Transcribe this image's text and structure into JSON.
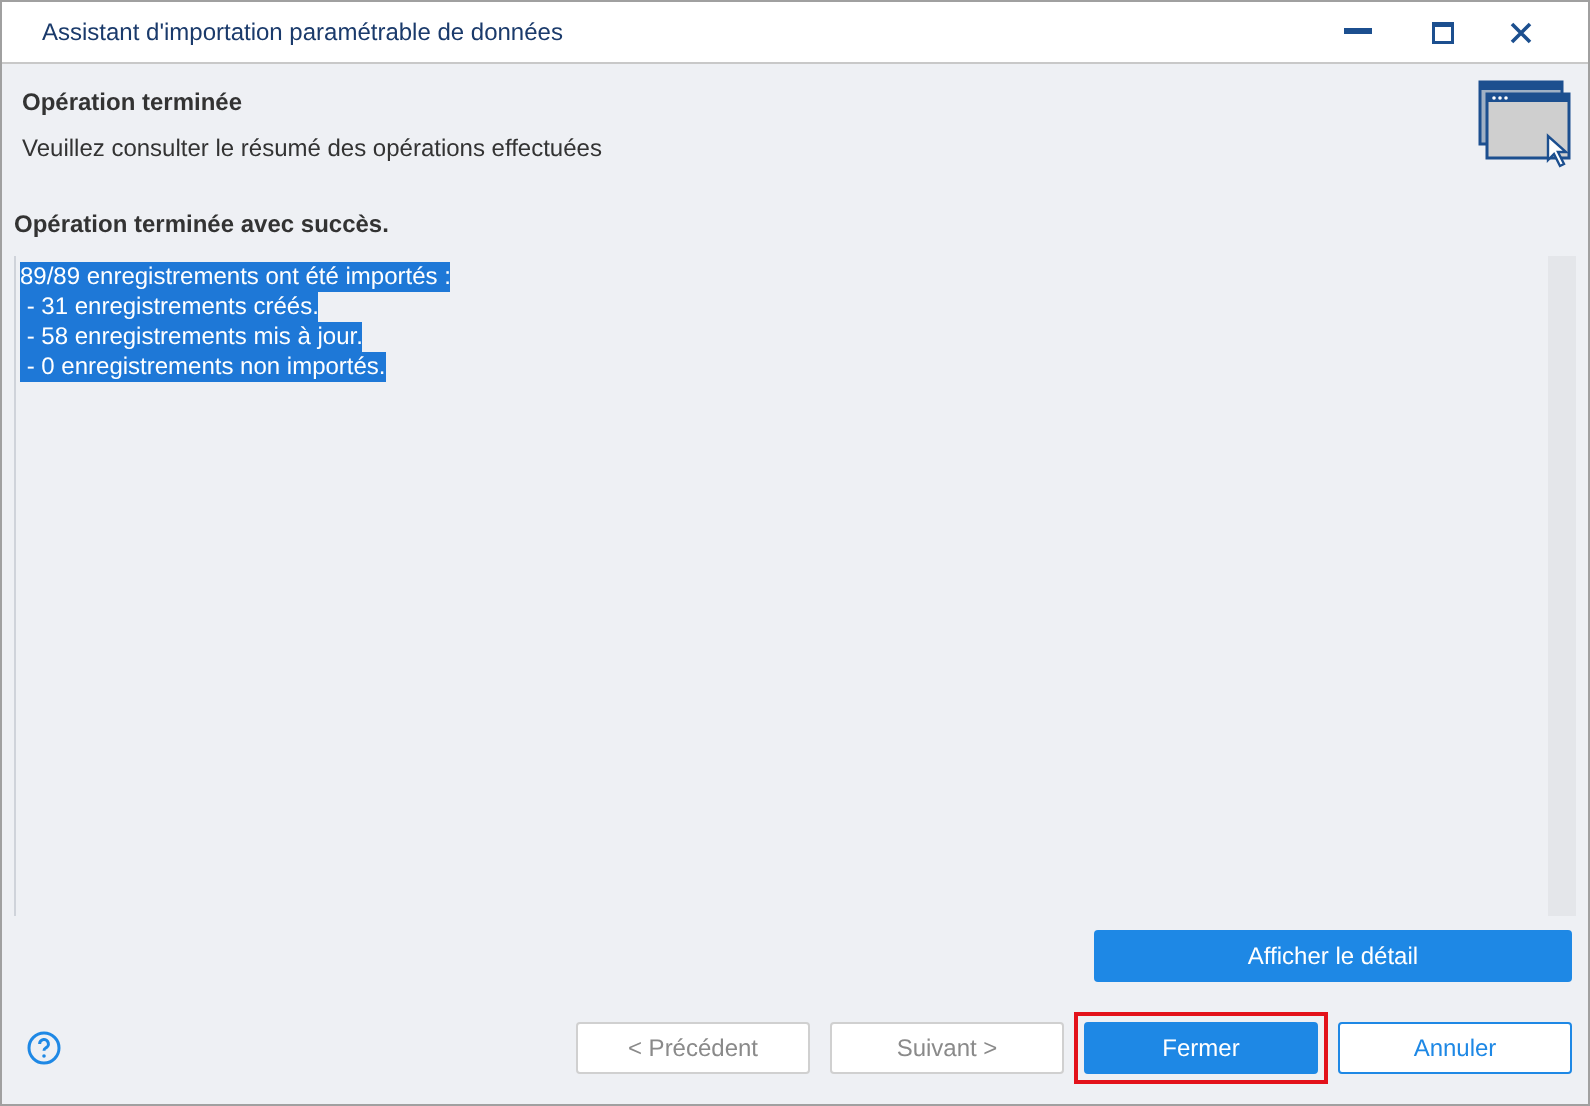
{
  "window": {
    "title": "Assistant d'importation paramétrable de données"
  },
  "header": {
    "title": "Opération terminée",
    "subtitle": "Veuillez consulter le résumé des opérations effectuées"
  },
  "status": "Opération terminée avec succès.",
  "log": {
    "selected": true,
    "lines": [
      "89/89 enregistrements ont été importés :",
      " - 31 enregistrements créés.",
      " - 58 enregistrements mis à jour.",
      " - 0 enregistrements non importés."
    ]
  },
  "detail_button": "Afficher le détail",
  "buttons": [
    {
      "label": "< Précédent",
      "kind": "secondary",
      "disabled": true,
      "highlighted": false
    },
    {
      "label": "Suivant >",
      "kind": "secondary",
      "disabled": true,
      "highlighted": false
    },
    {
      "label": "Fermer",
      "kind": "primary",
      "disabled": false,
      "highlighted": true
    },
    {
      "label": "Annuler",
      "kind": "outline",
      "disabled": false,
      "highlighted": false
    }
  ]
}
